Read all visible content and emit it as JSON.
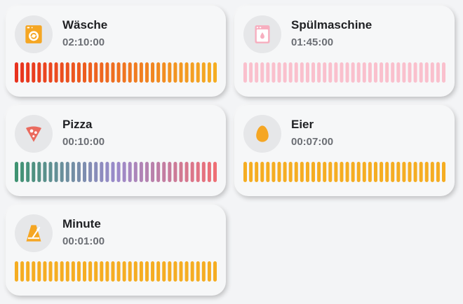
{
  "timers": [
    {
      "name": "Wäsche",
      "time": "02:10:00",
      "icon": "washing-machine-icon",
      "icon_color": "#f5a623",
      "bar_colors": [
        "#e8321e",
        "#f5ad22"
      ]
    },
    {
      "name": "Spülmaschine",
      "time": "01:45:00",
      "icon": "dishwasher-icon",
      "icon_color": "#f7aebf",
      "bar_colors": [
        "#fac0cd",
        "#fac0cd"
      ]
    },
    {
      "name": "Pizza",
      "time": "00:10:00",
      "icon": "pizza-icon",
      "icon_color": "#ea6b5f",
      "bar_colors": [
        "#3f9372",
        "#9a8acb",
        "#ee6f75"
      ]
    },
    {
      "name": "Eier",
      "time": "00:07:00",
      "icon": "egg-icon",
      "icon_color": "#f5a623",
      "bar_colors": [
        "#f5ad22",
        "#f5ad22"
      ]
    },
    {
      "name": "Minute",
      "time": "00:01:00",
      "icon": "metronome-icon",
      "icon_color": "#f5a623",
      "bar_colors": [
        "#f5ad22",
        "#f5ad22"
      ]
    }
  ]
}
